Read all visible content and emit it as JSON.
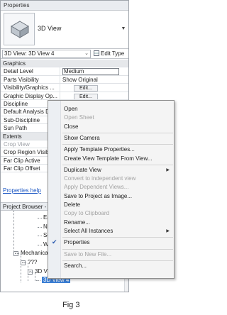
{
  "properties": {
    "title": "Properties",
    "type_name": "3D View",
    "instance_selector": "3D View: 3D View 4",
    "edit_type_label": "Edit Type",
    "rows": [
      {
        "kind": "cat",
        "label": "Graphics"
      },
      {
        "kind": "prop",
        "key": "Detail Level",
        "value": "Medium",
        "value_style": "framed"
      },
      {
        "kind": "prop",
        "key": "Parts Visibility",
        "value": "Show Original"
      },
      {
        "kind": "prop",
        "key": "Visibility/Graphics ...",
        "button": "Edit..."
      },
      {
        "kind": "prop",
        "key": "Graphic Display Op...",
        "button": "Edit..."
      },
      {
        "kind": "prop",
        "key": "Discipline",
        "value": ""
      },
      {
        "kind": "prop",
        "key": "Default Analysis D",
        "value": ""
      },
      {
        "kind": "prop",
        "key": "Sub-Discipline",
        "value": ""
      },
      {
        "kind": "prop",
        "key": "Sun Path",
        "value": ""
      },
      {
        "kind": "cat",
        "label": "Extents"
      },
      {
        "kind": "prop",
        "key": "Crop View",
        "value": "",
        "greyed": true
      },
      {
        "kind": "prop",
        "key": "Crop Region Visib",
        "value": ""
      },
      {
        "kind": "prop",
        "key": "Far Clip Active",
        "value": ""
      },
      {
        "kind": "prop",
        "key": "Far Clip Offset",
        "value": ""
      }
    ],
    "help_link": "Properties help"
  },
  "project_browser": {
    "title": "Project Browser - JP",
    "tree": [
      {
        "label": "Eas"
      },
      {
        "label": "No"
      },
      {
        "label": "Sou"
      },
      {
        "label": "We"
      },
      {
        "label": "Mechanical",
        "toggle": "-"
      },
      {
        "label": "???",
        "toggle": "-"
      },
      {
        "label": "3D Vie",
        "toggle": "-"
      },
      {
        "label": "3D View 4",
        "selected": true
      }
    ]
  },
  "context_menu": {
    "items": [
      {
        "label": "Open"
      },
      {
        "label": "Open Sheet",
        "disabled": true
      },
      {
        "label": "Close"
      },
      {
        "sep": true
      },
      {
        "label": "Show Camera"
      },
      {
        "sep": true
      },
      {
        "label": "Apply Template Properties..."
      },
      {
        "label": "Create View Template From View..."
      },
      {
        "sep": true
      },
      {
        "label": "Duplicate View",
        "submenu": true
      },
      {
        "label": "Convert to independent view",
        "disabled": true
      },
      {
        "label": "Apply Dependent Views...",
        "disabled": true
      },
      {
        "label": "Save to Project as Image..."
      },
      {
        "label": "Delete"
      },
      {
        "label": "Copy to Clipboard",
        "disabled": true
      },
      {
        "label": "Rename..."
      },
      {
        "label": "Select All Instances",
        "submenu": true
      },
      {
        "sep": true
      },
      {
        "label": "Properties",
        "checked": true
      },
      {
        "sep": true
      },
      {
        "label": "Save to New File...",
        "disabled": true
      },
      {
        "sep": true
      },
      {
        "label": "Search..."
      }
    ]
  },
  "caption": "Fig 3"
}
